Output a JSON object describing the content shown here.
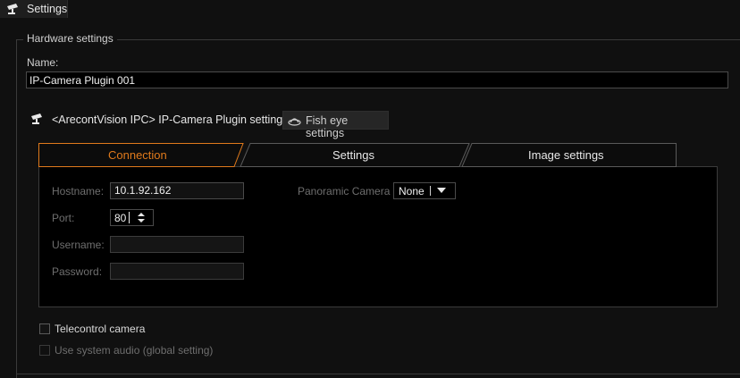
{
  "window": {
    "tab_title": "Settings"
  },
  "hardware": {
    "group_title": "Hardware settings",
    "name_label": "Name:",
    "name_value": "IP-Camera Plugin 001"
  },
  "plugin_tabs": {
    "plugin_settings_label": "<ArecontVision IPC> IP-Camera Plugin settings",
    "fisheye_label": "Fish eye settings"
  },
  "tabs": [
    {
      "label": "Connection",
      "active": true
    },
    {
      "label": "Settings",
      "active": false
    },
    {
      "label": "Image settings",
      "active": false
    }
  ],
  "connection": {
    "hostname_label": "Hostname:",
    "hostname_value": "10.1.92.162",
    "port_label": "Port:",
    "port_value": "80",
    "username_label": "Username:",
    "username_value": "",
    "password_label": "Password:",
    "password_value": "",
    "panoramic_label": "Panoramic Camera",
    "panoramic_value": "None"
  },
  "options": {
    "telecontrol_label": "Telecontrol camera",
    "telecontrol_checked": false,
    "system_audio_label": "Use system audio (global setting)",
    "system_audio_checked": false
  },
  "colors": {
    "accent": "#e07a1c",
    "background": "#101010",
    "panel": "#000000"
  },
  "icons": [
    "camera-icon",
    "fisheye-icon",
    "spin-up-icon",
    "spin-down-icon",
    "dropdown-arrow-icon"
  ]
}
